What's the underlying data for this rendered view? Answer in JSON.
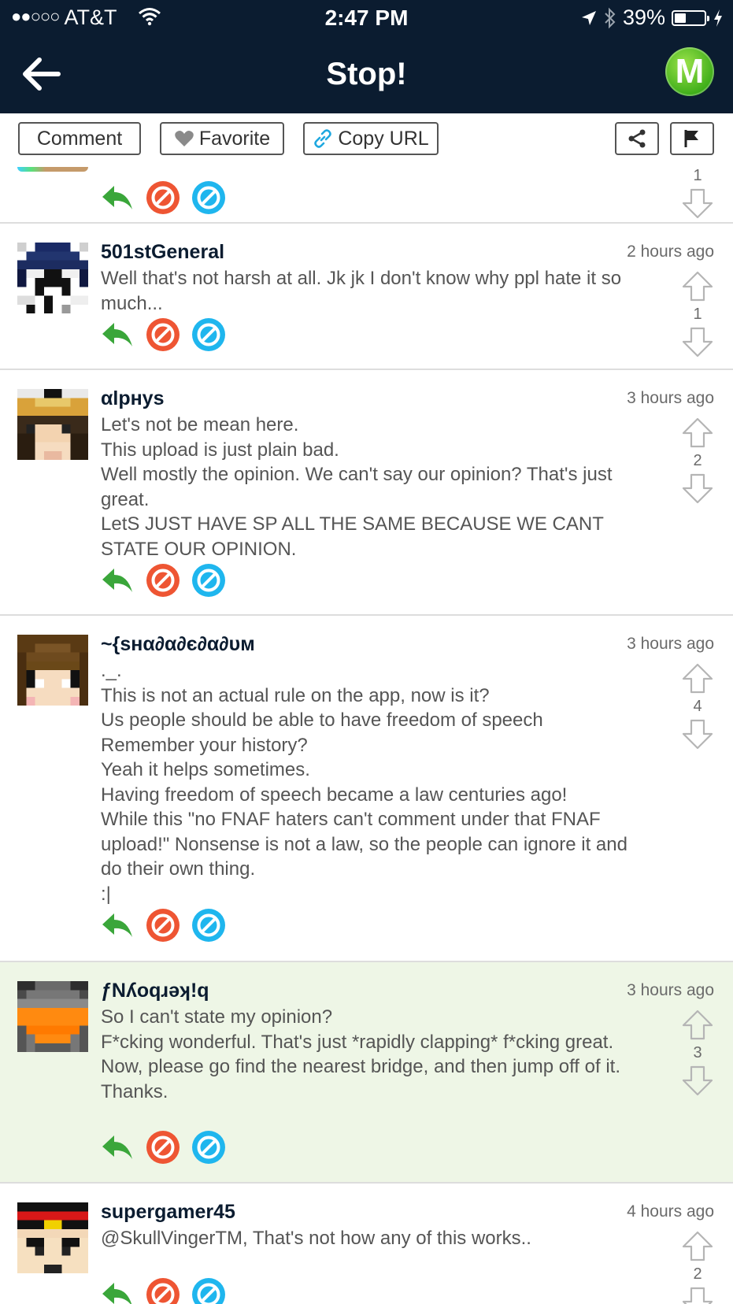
{
  "status_bar": {
    "signal": "●●○○○",
    "carrier": "AT&T",
    "time": "2:47 PM",
    "battery": "39%",
    "battery_level": 0.39
  },
  "nav": {
    "title": "Stop!",
    "logo_letter": "M"
  },
  "toolbar": {
    "comment_label": "Comment",
    "favorite_label": "Favorite",
    "copy_url_label": "Copy URL"
  },
  "partial_comment": {
    "votes": "1"
  },
  "comments": [
    {
      "username": "501stGeneral",
      "time": "2 hours ago",
      "text": "Well that's not harsh at all. Jk jk I don't know why ppl hate it so much...",
      "votes": "1"
    },
    {
      "username": "αlpнys",
      "time": "3 hours ago",
      "text": "Let's not be mean here.\nThis upload is just plain bad.\nWell mostly the opinion. We can't say our opinion? That's just great.\nLetS JUST HAVE SP ALL THE SAME BECAUSE WE CANT STATE OUR OPINION.",
      "votes": "2"
    },
    {
      "username": "~{sнα∂α∂є∂α∂υм",
      "time": "3 hours ago",
      "text": "._.\nThis is not an actual rule on the app, now is it?\nUs people should be able to have freedom of speech\nRemember your history?\nYeah it helps sometimes.\nHaving freedom of speech became a law centuries ago!\nWhile this \"no FNAF haters can't comment under that FNAF upload!\" Nonsense is not a law, so the people can ignore it and do their own thing.\n:|",
      "votes": "4"
    },
    {
      "username": "ƒNʎoqɹǝʞ!q",
      "time": "3 hours ago",
      "text": "So I can't state my opinion?\nF*cking wonderful. That's just *rapidly clapping* f*cking great.\nNow, please go find the nearest bridge, and then jump off of it. Thanks.",
      "votes": "3",
      "highlighted": true
    },
    {
      "username": "supergamer45",
      "time": "4 hours ago",
      "text": "@SkullVingerTM, That's not how any of this works..",
      "votes": "2"
    }
  ],
  "colors": {
    "navy": "#0b1c30",
    "reply_green": "#3aa63a",
    "block_red": "#ee5533",
    "report_blue": "#1fb6ee",
    "highlight_bg": "#eef6e6"
  }
}
